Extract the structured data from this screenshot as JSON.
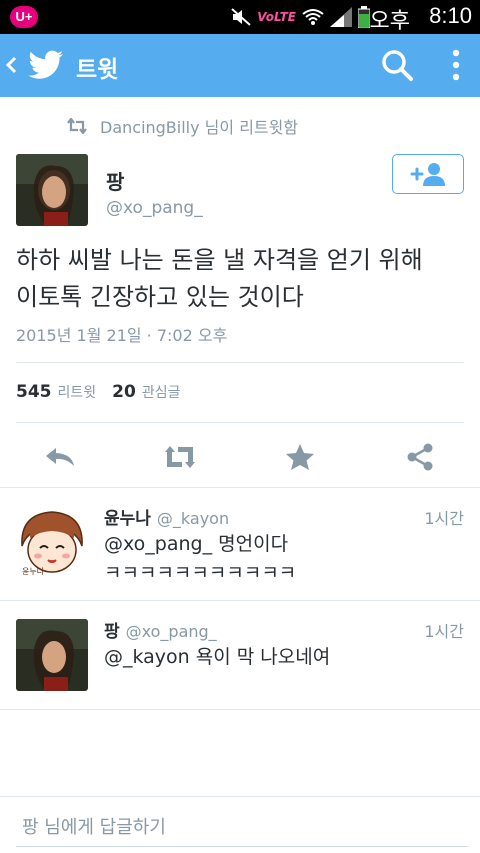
{
  "status_bar": {
    "carrier": "U+",
    "volte": "VoLTE",
    "ampm": "오후",
    "time": "8:10"
  },
  "action_bar": {
    "title": "트윗",
    "icons": [
      "back-icon",
      "twitter-bird-icon",
      "search-icon",
      "more-icon"
    ]
  },
  "retweet_header": {
    "text": "DancingBilly 님이 리트윗함"
  },
  "tweet": {
    "name": "팡",
    "handle": "@xo_pang_",
    "text_line1": "하하 씨발 나는 돈을 낼 자격을 얻기 위해",
    "text_line2": "이토톡 긴장하고 있는 것이다",
    "timestamp": "2015년 1월 21일 · 7:02 오후",
    "retweet_count": "545",
    "retweet_label": "리트윗",
    "favorite_count": "20",
    "favorite_label": "관심글"
  },
  "replies": [
    {
      "name": "윤누나",
      "handle": "@_kayon",
      "time": "1시간",
      "line1": "@xo_pang_ 명언이다",
      "line2": "ㅋㅋㅋㅋㅋㅋㅋㅋㅋㅋㅋ"
    },
    {
      "name": "팡",
      "handle": "@xo_pang_",
      "time": "1시간",
      "line1": "@_kayon 욕이 막 나오네여",
      "line2": ""
    }
  ],
  "compose": {
    "placeholder": "팡 님에게 답글하기"
  },
  "colors": {
    "accent": "#55acee",
    "muted": "#8899a6",
    "text": "#292f33"
  }
}
